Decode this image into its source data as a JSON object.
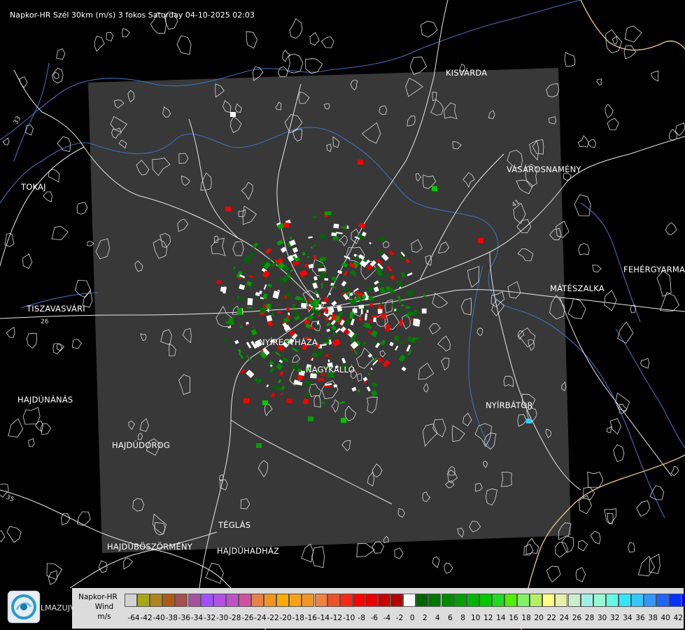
{
  "title": "Napkor-HR Szél 30km (m/s) 3 fokos Saturday 04-10-2025 02:03",
  "cities": {
    "kisvarda": "KISVÁRDA",
    "tokaj": "TOKAJ",
    "vasarosnameny": "VÁSÁROSNAMÉNY",
    "fehergyarmat": "FEHÉRGYARMA",
    "mateszalka": "MÁTÉSZALKA",
    "tiszavasvari": "TISZAVASVÁRI",
    "nyiregyhaza": "NYÍREGYHÁZA",
    "nagykallo": "NAGYKÁLLÓ",
    "hajdunanas": "HAJDÚNÁNÁS",
    "nyirbator": "NYÍRBÁTOR",
    "hajdudorog": "HAJDÚDOROG",
    "teglas": "TÉGLÁS",
    "hajduboszormeny": "HAJDÚBÖSZÖRMÉNY",
    "hajduhadhaz": "HAJDÚHADHÁZ"
  },
  "road_labels": {
    "r26": "26",
    "r35": "35",
    "r41": "41",
    "r33": "33"
  },
  "legend": {
    "title_line1": "Napkor-HR",
    "title_line2": "Wind",
    "title_line3": "m/s",
    "ticks": [
      "-64",
      "-42",
      "-40",
      "-38",
      "-36",
      "-34",
      "-32",
      "-30",
      "-28",
      "-26",
      "-24",
      "-22",
      "-20",
      "-18",
      "-16",
      "-14",
      "-12",
      "-10",
      "-8",
      "-6",
      "-4",
      "-2",
      "0",
      "2",
      "4",
      "6",
      "8",
      "10",
      "12",
      "14",
      "16",
      "18",
      "20",
      "22",
      "24",
      "26",
      "28",
      "30",
      "32",
      "34",
      "36",
      "38",
      "40",
      "42"
    ],
    "colors": [
      "#d2d2d2",
      "#a8a814",
      "#b0841c",
      "#ac5a14",
      "#a45050",
      "#a550a0",
      "#a050ff",
      "#b450e6",
      "#c050c8",
      "#d250a0",
      "#e68246",
      "#f0961e",
      "#ffaa00",
      "#faa014",
      "#f09628",
      "#f08240",
      "#f05028",
      "#fa2814",
      "#ff0000",
      "#e60000",
      "#c80000",
      "#b40000",
      "#ffffff",
      "#006400",
      "#007800",
      "#008c00",
      "#00a000",
      "#00b400",
      "#00c800",
      "#1edc1e",
      "#50f000",
      "#82f064",
      "#b4f064",
      "#ffff82",
      "#e6f0aa",
      "#c8f0c8",
      "#a0f0e6",
      "#96fad2",
      "#64fae6",
      "#32e6ff",
      "#32c8ff",
      "#3296ff",
      "#1e64ff",
      "#0032ff",
      "#0000e6"
    ]
  },
  "brand_text": "LMAZUJVAR"
}
